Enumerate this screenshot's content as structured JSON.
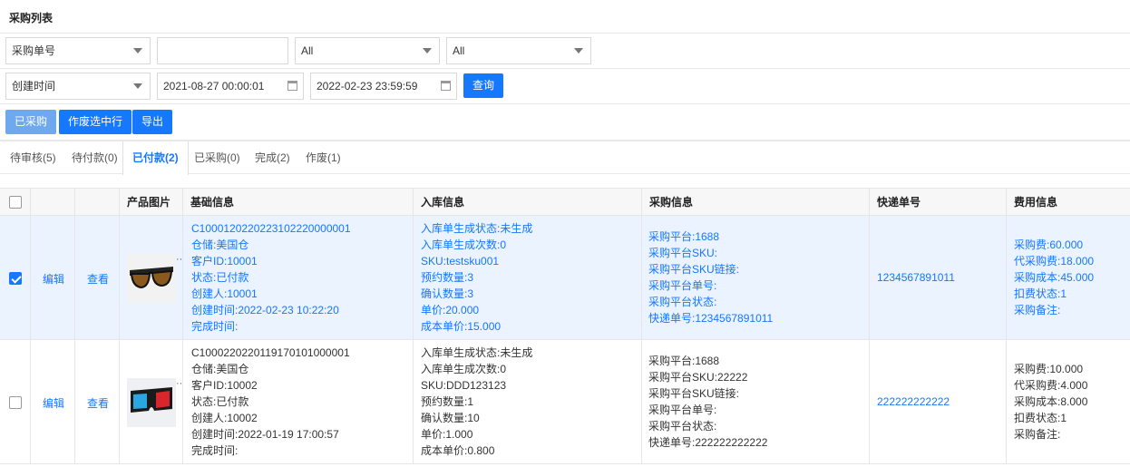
{
  "header": {
    "title": "采购列表"
  },
  "filters": {
    "order_field": "采购单号",
    "order_value": "",
    "status_a": "All",
    "status_b": "All",
    "time_field": "创建时间",
    "date_start": "2021-08-27 00:00:01",
    "date_end": "2022-02-23 23:59:59",
    "search_label": "查询"
  },
  "actions": {
    "purchased_label": "已采购",
    "void_label": "作废选中行",
    "export_label": "导出"
  },
  "tabs": [
    {
      "label": "待审核(5)"
    },
    {
      "label": "待付款(0)"
    },
    {
      "label": "已付款(2)"
    },
    {
      "label": "已采购(0)"
    },
    {
      "label": "完成(2)"
    },
    {
      "label": "作废(1)"
    }
  ],
  "table": {
    "headers": {
      "image": "产品图片",
      "basic": "基础信息",
      "inbound": "入库信息",
      "purchase": "采购信息",
      "tracking": "快递单号",
      "fee": "费用信息"
    },
    "rows": [
      {
        "checked": true,
        "edit": "编辑",
        "view": "查看",
        "image_icon": "sunglasses-icon",
        "basic": [
          "C1000120220223102220000001",
          "仓储:美国仓",
          "客户ID:10001",
          "状态:已付款",
          "创建人:10001",
          "创建时间:2022-02-23 10:22:20",
          "完成时间:"
        ],
        "inbound": [
          "入库单生成状态:未生成",
          "入库单生成次数:0",
          "SKU:testsku001",
          "预约数量:3",
          "确认数量:3",
          "单价:20.000",
          "成本单价:15.000"
        ],
        "purchase": [
          "采购平台:1688",
          "采购平台SKU:",
          "采购平台SKU链接:",
          "采购平台单号:",
          "采购平台状态:",
          "快递单号:1234567891011"
        ],
        "tracking": "1234567891011",
        "fee": [
          "采购费:60.000",
          "代采购费:18.000",
          "采购成本:45.000",
          "扣费状态:1",
          "采购备注:"
        ]
      },
      {
        "checked": false,
        "edit": "编辑",
        "view": "查看",
        "image_icon": "3d-glasses-icon",
        "basic": [
          "C1000220220119170101000001",
          "仓储:美国仓",
          "客户ID:10002",
          "状态:已付款",
          "创建人:10002",
          "创建时间:2022-01-19 17:00:57",
          "完成时间:"
        ],
        "inbound": [
          "入库单生成状态:未生成",
          "入库单生成次数:0",
          "SKU:DDD123123",
          "预约数量:1",
          "确认数量:10",
          "单价:1.000",
          "成本单价:0.800"
        ],
        "purchase": [
          "采购平台:1688",
          "采购平台SKU:22222",
          "采购平台SKU链接:",
          "采购平台单号:",
          "采购平台状态:",
          "快递单号:222222222222"
        ],
        "tracking": "222222222222",
        "fee": [
          "采购费:10.000",
          "代采购费:4.000",
          "采购成本:8.000",
          "扣费状态:1",
          "采购备注:"
        ]
      }
    ]
  }
}
